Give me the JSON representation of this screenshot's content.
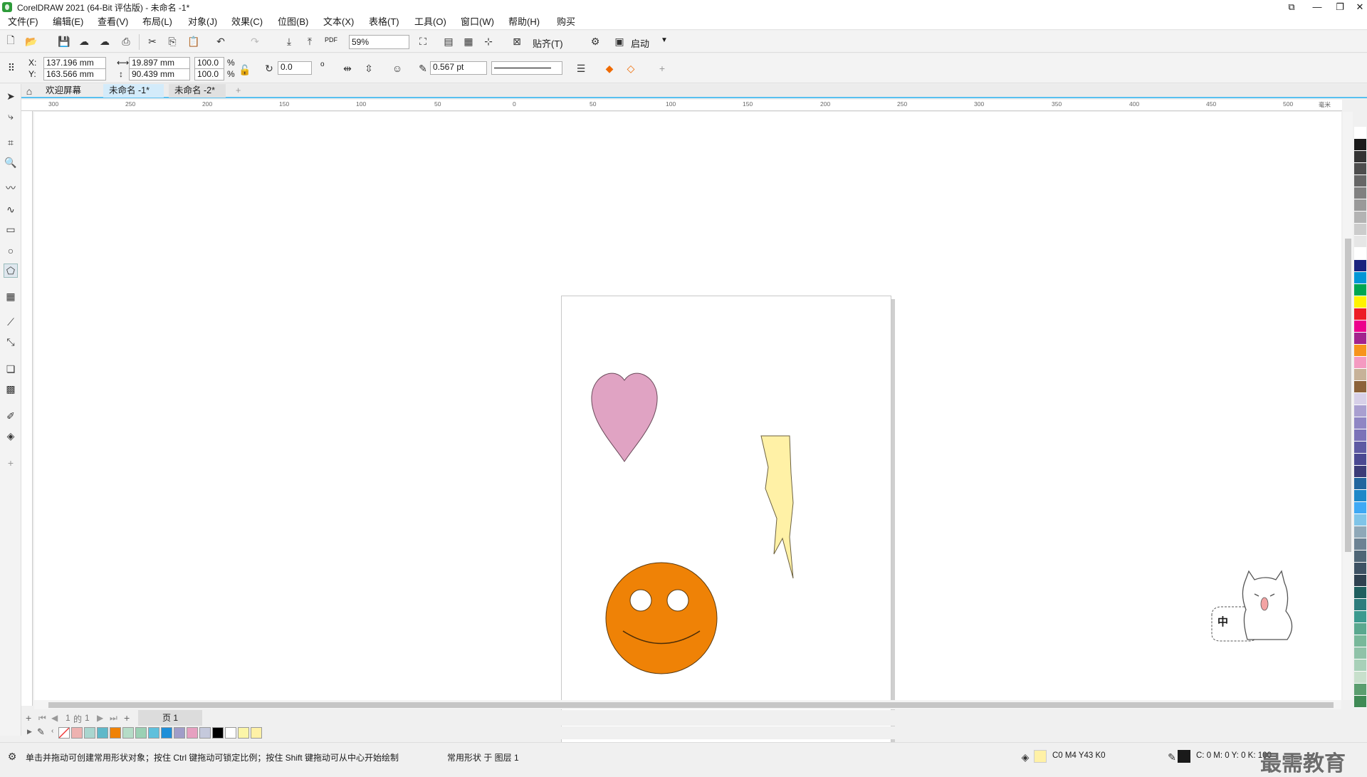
{
  "window": {
    "title": "CorelDRAW 2021 (64-Bit 评估版) - 未命名 -1*"
  },
  "menu": [
    "文件(F)",
    "编辑(E)",
    "查看(V)",
    "布局(L)",
    "对象(J)",
    "效果(C)",
    "位图(B)",
    "文本(X)",
    "表格(T)",
    "工具(O)",
    "窗口(W)",
    "帮助(H)",
    "购买"
  ],
  "toolbar": {
    "zoom": "59%",
    "snap_label": "贴齐(T)",
    "launch_label": "启动",
    "pdf_label": "PDF"
  },
  "props": {
    "x_label": "X:",
    "y_label": "Y:",
    "x": "137.196 mm",
    "y": "163.566 mm",
    "w": "19.897 mm",
    "h": "90.439 mm",
    "sx": "100.0",
    "sy": "100.0",
    "pct": "%",
    "angle": "0.0",
    "deg": "o",
    "outline": "0.567 pt"
  },
  "tabs": [
    {
      "label": "欢迎屏幕"
    },
    {
      "label": "未命名 -1*"
    },
    {
      "label": "未命名 -2*"
    }
  ],
  "ruler": {
    "ticks": [
      "300",
      "250",
      "200",
      "150",
      "100",
      "50",
      "0",
      "50",
      "100",
      "150",
      "200",
      "250",
      "300",
      "350",
      "400",
      "450",
      "500"
    ],
    "unit": "毫米"
  },
  "pagenav": {
    "current": "1",
    "of": "的",
    "total": "1",
    "page_tab": "页 1"
  },
  "status": {
    "hint": "单击并拖动可创建常用形状对象；按住 Ctrl 键拖动可锁定比例；按住 Shift 键拖动可从中心开始绘制",
    "object": "常用形状 于 图层 1",
    "fill": "C0 M4 Y43 K0",
    "outline": "C: 0 M: 0 Y: 0 K: 100"
  },
  "badge": {
    "cat_label": "中",
    "watermark": "最需教育"
  },
  "colors": {
    "heart": "#e0a3c3",
    "bolt": "#fff1a6",
    "face": "#ef8206",
    "accent": "#58c0f0"
  },
  "doc_swatches": [
    "#eeb2b0",
    "#a9d6cf",
    "#5fb8c9",
    "#ef8206",
    "#b5dcc7",
    "#9bd0b4",
    "#5fc0dc",
    "#1f8fd8",
    "#a09dc8",
    "#e6a0c0",
    "#c5c9dc",
    "#000000",
    "#ffffff",
    "#fbf5a8",
    "#fff1a6"
  ],
  "palette_colors": [
    "#ffffff",
    "#1a1a1a",
    "#333333",
    "#4d4d4d",
    "#666666",
    "#808080",
    "#999999",
    "#b3b3b3",
    "#cccccc",
    "#e6e6e6",
    "#ffffff",
    "#1a237e",
    "#0096d6",
    "#00a651",
    "#fff200",
    "#ed1c24",
    "#ec008c",
    "#a3238e",
    "#f7941d",
    "#f49ac1",
    "#c7b299",
    "#8c6239",
    "#d7d0e8",
    "#a99fd0",
    "#8f86c4",
    "#7b72b8",
    "#5e5aa3",
    "#4b4992",
    "#3c3c78",
    "#22669e",
    "#1e88c8",
    "#3fa9f5",
    "#7fc4e8",
    "#8fa8b8",
    "#6c8293",
    "#4f6676",
    "#3e5264",
    "#2f4150",
    "#1f5f5f",
    "#2e7d7d",
    "#3b9a8f",
    "#5aa88f",
    "#78b89a",
    "#8fc2a8",
    "#a8d0b8",
    "#c8e0cc",
    "#5b9e6f",
    "#3f8a55"
  ]
}
